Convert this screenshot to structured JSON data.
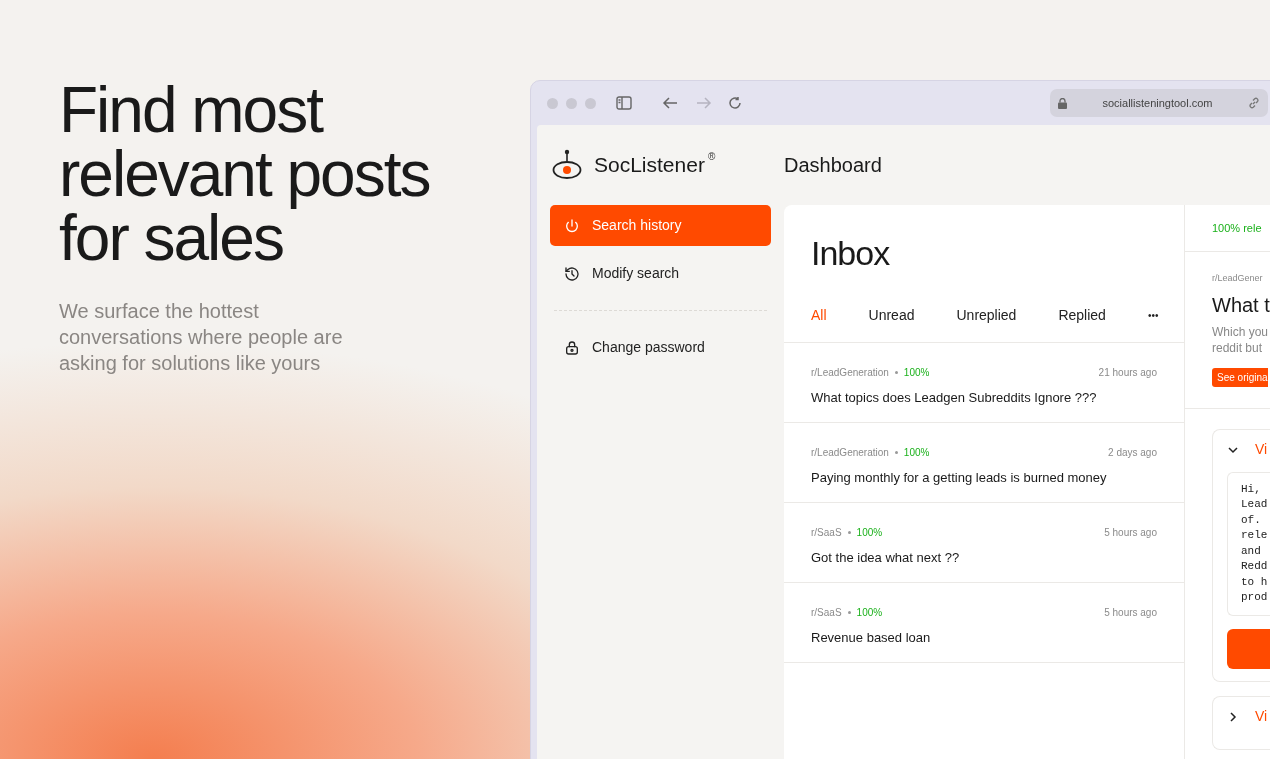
{
  "hero": {
    "title": "Find most relevant posts for sales",
    "subtitle": "We surface the hottest conversations where people are asking for solutions like yours"
  },
  "browser": {
    "url": "sociallisteningtool.com"
  },
  "app": {
    "brand": "SocListener",
    "brand_mark": "®",
    "page_title": "Dashboard"
  },
  "sidebar": {
    "items": [
      {
        "label": "Search history",
        "selected": true
      },
      {
        "label": "Modify search",
        "selected": false
      },
      {
        "label": "Change password",
        "selected": false
      }
    ]
  },
  "inbox": {
    "title": "Inbox",
    "more": "•••",
    "tabs": [
      {
        "label": "All",
        "selected": true
      },
      {
        "label": "Unread",
        "selected": false
      },
      {
        "label": "Unreplied",
        "selected": false
      },
      {
        "label": "Replied",
        "selected": false
      }
    ],
    "posts": [
      {
        "subreddit": "r/LeadGeneration",
        "score": "100%",
        "time": "21 hours ago",
        "title": "What topics does Leadgen Subreddits Ignore ???"
      },
      {
        "subreddit": "r/LeadGeneration",
        "score": "100%",
        "time": "2 days ago",
        "title": "Paying monthly for a getting leads is burned money"
      },
      {
        "subreddit": "r/SaaS",
        "score": "100%",
        "time": "5 hours ago",
        "title": "Got the idea what next ??"
      },
      {
        "subreddit": "r/SaaS",
        "score": "100%",
        "time": "5 hours ago",
        "title": "Revenue based loan"
      }
    ]
  },
  "detail": {
    "relevance": "100% rele",
    "subreddit": "r/LeadGener",
    "title": "What t",
    "body": [
      "Which you",
      "reddit but"
    ],
    "badge": "See origina",
    "sections": [
      {
        "label": "Vi",
        "expanded": true,
        "lines": [
          "Hi,",
          "Lead",
          "of.",
          "rele",
          "and",
          "Redd",
          "to h",
          "prod"
        ]
      },
      {
        "label": "Vi",
        "expanded": false
      }
    ]
  }
}
